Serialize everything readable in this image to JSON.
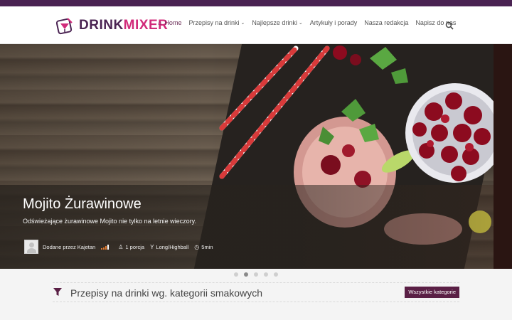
{
  "brand": {
    "logo_part1": "DRINK",
    "logo_part2": "MIXER",
    "primary_color": "#4a2352",
    "accent_color": "#d12a7a"
  },
  "nav": {
    "items": [
      {
        "label": "Home",
        "icon": "home-icon",
        "active": true
      },
      {
        "label": "Przepisy na drinki",
        "dropdown": true
      },
      {
        "label": "Najlepsze drinki",
        "dropdown": true
      },
      {
        "label": "Artykuły i porady"
      },
      {
        "label": "Nasza redakcja"
      },
      {
        "label": "Napisz do nas"
      }
    ],
    "search_icon": "search-icon"
  },
  "hero": {
    "title": "Mojito Żurawinowe",
    "description": "Odświeżające żurawinowe Mojito nie tylko na letnie wieczory.",
    "author": "Dodane przez Kajetan",
    "difficulty_icon": "difficulty-bars-icon",
    "servings": "1 porcja",
    "glass": "Long/Highball",
    "time": "5min"
  },
  "carousel": {
    "slides": 5,
    "active_index": 1
  },
  "section": {
    "title": "Przepisy na drinki wg. kategorii smakowych",
    "button_label": "Wszystkie kategorie",
    "icon": "filter-icon"
  }
}
